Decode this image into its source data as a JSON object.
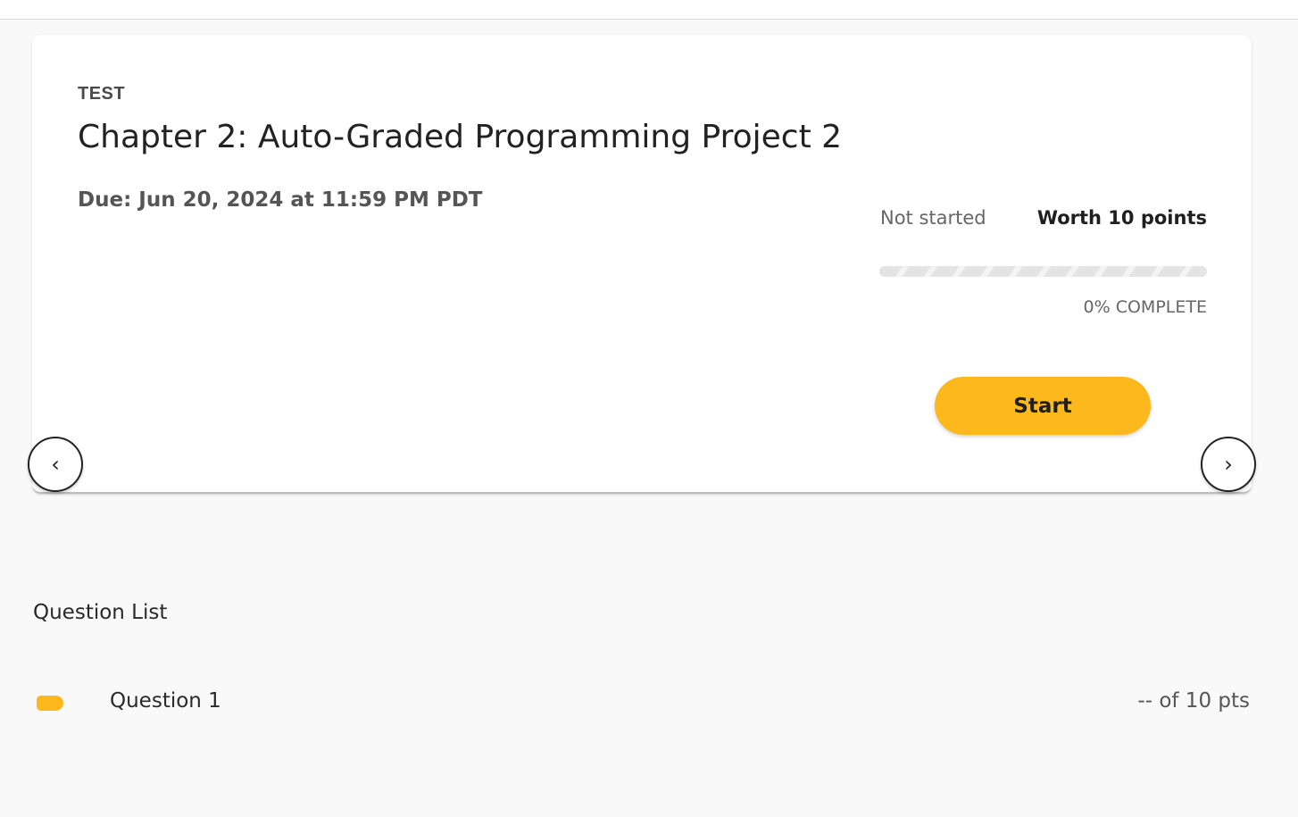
{
  "assignment": {
    "type_label": "TEST",
    "title": "Chapter 2: Auto-Graded Programming Project 2",
    "due": "Due: Jun 20, 2024 at 11:59 PM PDT",
    "status": "Not started",
    "worth": "Worth 10 points",
    "progress_percent": 0,
    "progress_label": "0% COMPLETE",
    "start_label": "Start"
  },
  "navigation": {
    "prev_glyph": "‹",
    "next_glyph": "›",
    "prev_icon": "chevron-left-icon",
    "next_icon": "chevron-right-icon"
  },
  "question_list": {
    "heading": "Question List",
    "items": [
      {
        "label": "Question 1",
        "score": "-- of 10 pts",
        "tag_color": "#fcb81d"
      }
    ]
  },
  "colors": {
    "accent": "#fcb81d",
    "background": "#f9f9f9"
  }
}
